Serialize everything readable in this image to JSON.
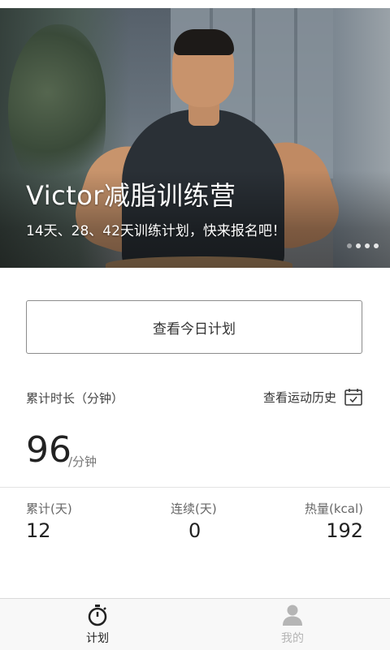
{
  "banner": {
    "title": "Victor减脂训练营",
    "subtitle": "14天、28、42天训练计划，快来报名吧！",
    "page_indicator": {
      "count": 4,
      "active": 0
    }
  },
  "plan_button": {
    "label": "查看今日计划"
  },
  "stats": {
    "cumulative_label": "累计时长（分钟）",
    "history_link": "查看运动历史",
    "total_minutes": "96",
    "total_unit": "/分钟",
    "days_label": "累计(天)",
    "days_value": "12",
    "streak_label": "连续(天)",
    "streak_value": "0",
    "calories_label": "热量(kcal)",
    "calories_value": "192"
  },
  "tabs": [
    {
      "label": "计划",
      "icon": "stopwatch-icon",
      "active": true
    },
    {
      "label": "我的",
      "icon": "user-icon",
      "active": false
    }
  ],
  "colors": {
    "text_primary": "#222222",
    "tab_active": "#222222",
    "tab_inactive": "#b5b5b5",
    "divider": "#e3e3e3"
  }
}
